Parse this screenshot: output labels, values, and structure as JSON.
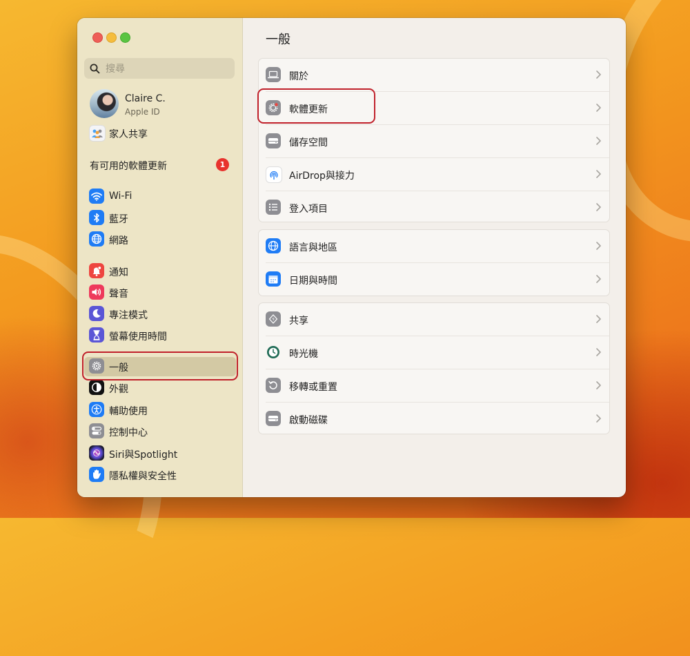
{
  "window": {
    "sidebar": {
      "search": {
        "placeholder": "搜尋"
      },
      "profile": {
        "name": "Claire C.",
        "subtitle": "Apple ID"
      },
      "family_sharing": "家人共享",
      "update_notice": {
        "label": "有可用的軟體更新",
        "badge": "1"
      },
      "items": [
        {
          "label": "Wi-Fi",
          "icon": "wifi-icon"
        },
        {
          "label": "藍牙",
          "icon": "bluetooth-icon"
        },
        {
          "label": "網路",
          "icon": "globe-icon"
        },
        {
          "label": "通知",
          "icon": "bell-icon"
        },
        {
          "label": "聲音",
          "icon": "speaker-icon"
        },
        {
          "label": "專注模式",
          "icon": "moon-icon"
        },
        {
          "label": "螢幕使用時間",
          "icon": "hourglass-icon"
        },
        {
          "label": "一般",
          "icon": "gear-icon",
          "selected": true
        },
        {
          "label": "外觀",
          "icon": "appearance-icon"
        },
        {
          "label": "輔助使用",
          "icon": "accessibility-icon"
        },
        {
          "label": "控制中心",
          "icon": "toggles-icon"
        },
        {
          "label": "Siri與Spotlight",
          "icon": "siri-icon"
        },
        {
          "label": "隱私權與安全性",
          "icon": "hand-icon"
        }
      ]
    },
    "main": {
      "title": "一般",
      "groups": [
        [
          {
            "label": "關於",
            "icon": "laptop-icon"
          },
          {
            "label": "軟體更新",
            "icon": "gear-badge-icon",
            "highlighted": true
          },
          {
            "label": "儲存空間",
            "icon": "drive-icon"
          },
          {
            "label": "AirDrop與接力",
            "icon": "airdrop-icon"
          },
          {
            "label": "登入項目",
            "icon": "list-icon"
          }
        ],
        [
          {
            "label": "語言與地區",
            "icon": "globe-icon"
          },
          {
            "label": "日期與時間",
            "icon": "calendar-icon"
          }
        ],
        [
          {
            "label": "共享",
            "icon": "share-icon"
          },
          {
            "label": "時光機",
            "icon": "clock-icon"
          },
          {
            "label": "移轉或重置",
            "icon": "reset-icon"
          },
          {
            "label": "啟動磁碟",
            "icon": "disk-icon"
          }
        ]
      ]
    }
  },
  "colors": {
    "accent_blue": "#1f7cf5",
    "highlight_red": "#c0202a",
    "badge_red": "#e8332d",
    "sidebar_bg": "#ede5c6"
  }
}
